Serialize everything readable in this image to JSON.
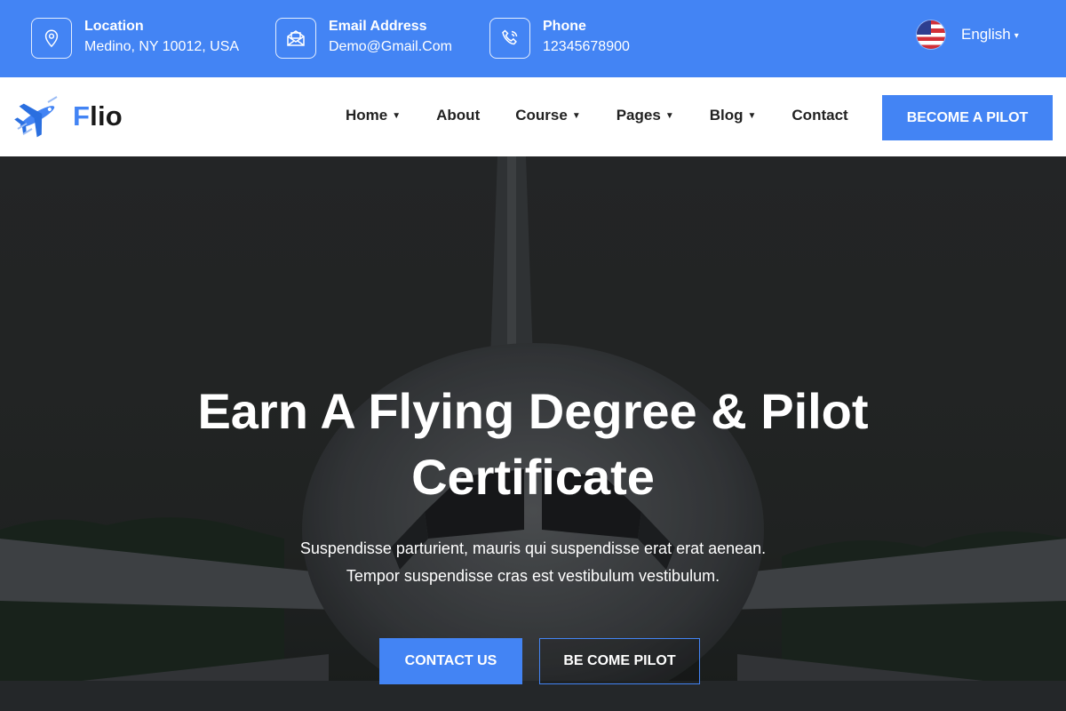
{
  "topbar": {
    "location": {
      "label": "Location",
      "value": "Medino, NY 10012, USA",
      "icon": "map-pin-icon"
    },
    "email": {
      "label": "Email Address",
      "value": "Demo@Gmail.Com",
      "icon": "envelope-icon"
    },
    "phone": {
      "label": "Phone",
      "value": "12345678900",
      "icon": "phone-icon"
    },
    "language": {
      "selected": "English",
      "flag": "us-flag-icon"
    }
  },
  "brand": {
    "name_first": "F",
    "name_rest": "lio"
  },
  "nav": {
    "items": [
      {
        "label": "Home",
        "has_dropdown": true
      },
      {
        "label": "About",
        "has_dropdown": false
      },
      {
        "label": "Course",
        "has_dropdown": true
      },
      {
        "label": "Pages",
        "has_dropdown": true
      },
      {
        "label": "Blog",
        "has_dropdown": true
      },
      {
        "label": "Contact",
        "has_dropdown": false
      }
    ],
    "cta_label": "BECOME A PILOT"
  },
  "hero": {
    "title_line1": "Earn A Flying Degree & Pilot",
    "title_line2": "Certificate",
    "subtitle_line1": "Suspendisse parturient, mauris qui suspendisse erat erat aenean.",
    "subtitle_line2": "Tempor suspendisse cras est vestibulum vestibulum.",
    "primary_button": "CONTACT US",
    "secondary_button": "BE COME PILOT"
  },
  "colors": {
    "accent": "#4384f4",
    "text_dark": "#222222",
    "hero_overlay": "#2a2c2c"
  }
}
